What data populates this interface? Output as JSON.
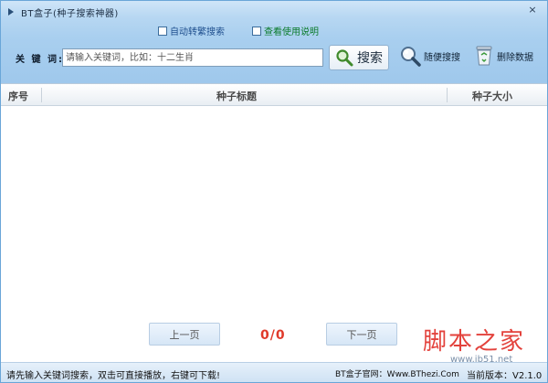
{
  "window": {
    "title": "BT盒子(种子搜索神器)",
    "close_glyph": "×"
  },
  "options": {
    "auto_convert_label": "自动转繁搜索",
    "view_help_label": "查看使用说明"
  },
  "search": {
    "keyword_label": "关 键 词:",
    "placeholder": "请输入关键词，比如：十二生肖",
    "search_label": "搜索",
    "random_label": "随便搜搜",
    "delete_label": "删除数据"
  },
  "table": {
    "columns": [
      "序号",
      "种子标题",
      "种子大小"
    ],
    "rows": []
  },
  "pager": {
    "prev_label": "上一页",
    "next_label": "下一页",
    "count": "0/0"
  },
  "status": {
    "message": "请先输入关键词搜索，双击可直接播放，右键可下载!",
    "site": "BT盒子官网：Www.BThezi.Com",
    "version": "当前版本：V2.1.0"
  },
  "watermark": {
    "title": "脚本之家",
    "url": "www.jb51.net"
  },
  "icons": {
    "app": "play-triangle-icon",
    "search": "magnifier-icon",
    "random": "magnifier-icon",
    "delete": "recycle-bin-icon"
  },
  "colors": {
    "toolbar_bg": "#a9cfef",
    "accent_red": "#e03a2a",
    "help_green": "#0a7a2a",
    "link_blue": "#1f4f8e"
  }
}
